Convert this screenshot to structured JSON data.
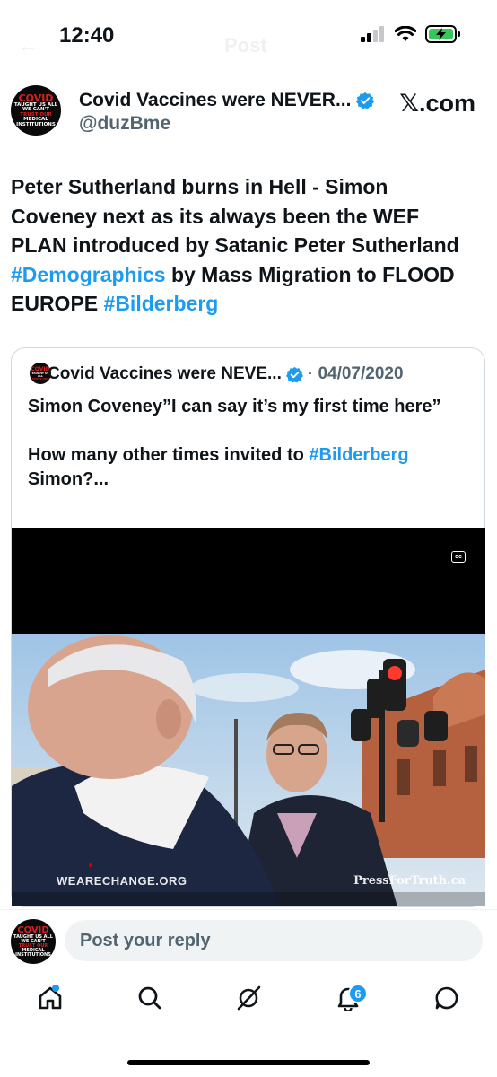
{
  "status_bar": {
    "time": "12:40",
    "ghost_title": "Post",
    "battery_color": "#34c759"
  },
  "post": {
    "author_name": "Covid Vaccines were NEVER...",
    "author_handle": "@duzBme",
    "brand": "𝕏.com",
    "avatar_text": {
      "line1": "COVID",
      "line2": "TAUGHT US ALL",
      "line3": "WE CAN'T",
      "line4": "TRUST OUR",
      "line5": "MEDICAL INSTITUTIONS"
    },
    "text_parts": {
      "p1": "Peter Sutherland burns in Hell - Simon Coveney next as its always been the WEF PLAN introduced by Satanic Peter Sutherland ",
      "tag1": "#Demographics",
      "p2": " by Mass Migration to FLOOD EUROPE ",
      "tag2": "#Bilderberg"
    }
  },
  "quote": {
    "author_name": "Covid Vaccines were NEVE...",
    "date": "· 04/07/2020",
    "line1": "Simon Coveney”I can say it’s my first time here”",
    "line2_prefix": "How many other times invited to ",
    "line2_tag": "#Bilderberg",
    "line2_suffix": " Simon?...",
    "video": {
      "cc_label": "cc",
      "watermark_left": "WEARECHANGE.ORG",
      "watermark_right": "PressForTruth.ca"
    }
  },
  "reply": {
    "placeholder": "Post your reply"
  },
  "tabs": {
    "notifications_badge": "6"
  },
  "colors": {
    "accent": "#1d9bf0",
    "text": "#0f1419",
    "secondary": "#536471"
  },
  "icons": [
    "signal-icon",
    "wifi-icon",
    "battery-icon",
    "verified-icon",
    "home-icon",
    "search-icon",
    "grok-icon",
    "notifications-icon",
    "messages-icon",
    "cc-icon"
  ]
}
